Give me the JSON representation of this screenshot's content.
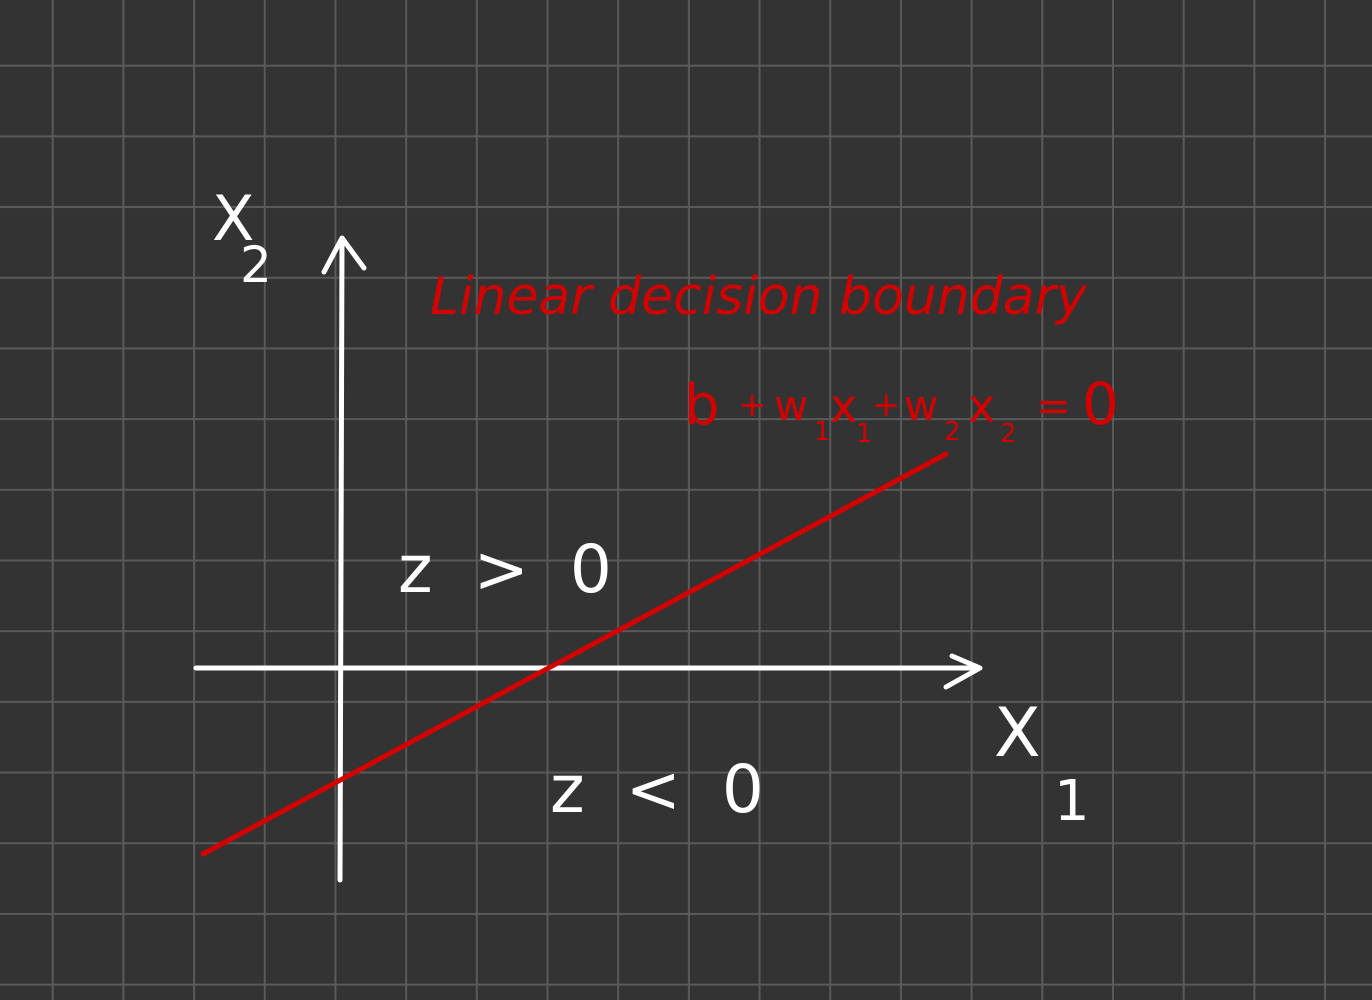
{
  "axes": {
    "x_label": "X",
    "x_subscript": "1",
    "y_label": "X",
    "y_subscript": "2"
  },
  "boundary": {
    "title": "Linear decision boundary",
    "equation": {
      "b": "b",
      "plus1": "+",
      "w1": "w",
      "w1_sub": "1",
      "x1": "x",
      "x1_sub": "1",
      "plus2": "+",
      "w2": "w",
      "w2_sub": "2",
      "x2": "x",
      "x2_sub": "2",
      "equals": "=",
      "zero": "0"
    }
  },
  "regions": {
    "above": "z > 0",
    "below": "z < 0"
  },
  "colors": {
    "background": "#333333",
    "grid": "#5a5a5a",
    "ink": "#ffffff",
    "accent": "#d40000"
  }
}
